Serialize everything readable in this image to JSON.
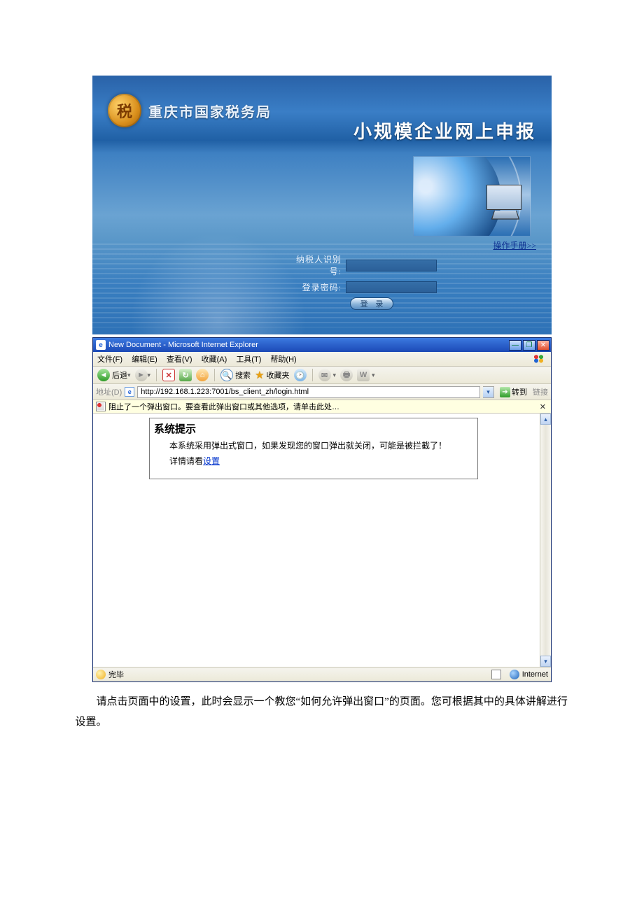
{
  "banner": {
    "emblem_char": "税",
    "org_name": "重庆市国家税务局",
    "system_title": "小规模企业网上申报",
    "manual_link": "操作手册>>",
    "labels": {
      "taxpayer_id": "纳税人识别号:",
      "password": "登录密码:"
    },
    "login_button": "登 录"
  },
  "ie": {
    "title": "New Document - Microsoft Internet Explorer",
    "menus": {
      "file": "文件(F)",
      "edit": "编辑(E)",
      "view": "查看(V)",
      "fav": "收藏(A)",
      "tools": "工具(T)",
      "help": "帮助(H)"
    },
    "toolbar": {
      "back": "后退",
      "search": "搜索",
      "favorites": "收藏夹"
    },
    "address": {
      "label": "地址(D)",
      "url": "http://192.168.1.223:7001/bs_client_zh/login.html",
      "go": "转到",
      "links": "链接"
    },
    "popup_bar": "阻止了一个弹出窗口。要查看此弹出窗口或其他选项，请单击此处…",
    "tipbox": {
      "title": "系统提示",
      "line1": "本系统采用弹出式窗口，如果发现您的窗口弹出就关闭，可能是被拦截了！",
      "line2_prefix": "详情请看",
      "line2_link": "设置"
    },
    "status": {
      "done": "完毕",
      "zone": "Internet"
    }
  },
  "caption": "请点击页面中的设置，此时会显示一个教您“如何允许弹出窗口”的页面。您可根据其中的具体讲解进行设置。"
}
